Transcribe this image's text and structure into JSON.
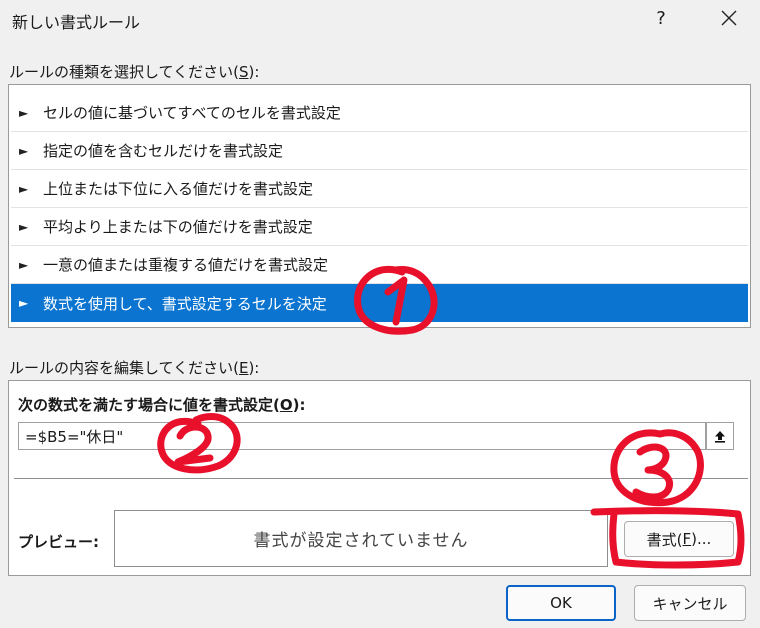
{
  "dialog": {
    "title": "新しい書式ルール",
    "help": "?"
  },
  "rule_type": {
    "label_main": "ルールの種類を選択してください(",
    "label_key": "S",
    "label_end": "):",
    "items": [
      {
        "label": "セルの値に基づいてすべてのセルを書式設定",
        "selected": false
      },
      {
        "label": "指定の値を含むセルだけを書式設定",
        "selected": false
      },
      {
        "label": "上位または下位に入る値だけを書式設定",
        "selected": false
      },
      {
        "label": "平均より上または下の値だけを書式設定",
        "selected": false
      },
      {
        "label": "一意の値または重複する値だけを書式設定",
        "selected": false
      },
      {
        "label": "数式を使用して、書式設定するセルを決定",
        "selected": true
      }
    ],
    "bullet": "►"
  },
  "rule_edit": {
    "label_main": "ルールの内容を編集してください(",
    "label_key": "E",
    "label_end": "):",
    "formula_label_main": "次の数式を満たす場合に値を書式設定(",
    "formula_label_key": "O",
    "formula_label_end": "):",
    "formula_value": "=$B5=\"休日\"",
    "preview_label": "プレビュー:",
    "preview_text": "書式が設定されていません",
    "format_button_main": "書式(",
    "format_button_key": "F",
    "format_button_end": ")..."
  },
  "buttons": {
    "ok": "OK",
    "cancel": "キャンセル"
  },
  "colors": {
    "selection": "#0a74d0",
    "annotation": "#e8102a",
    "default_button_border": "#0a64c8"
  }
}
